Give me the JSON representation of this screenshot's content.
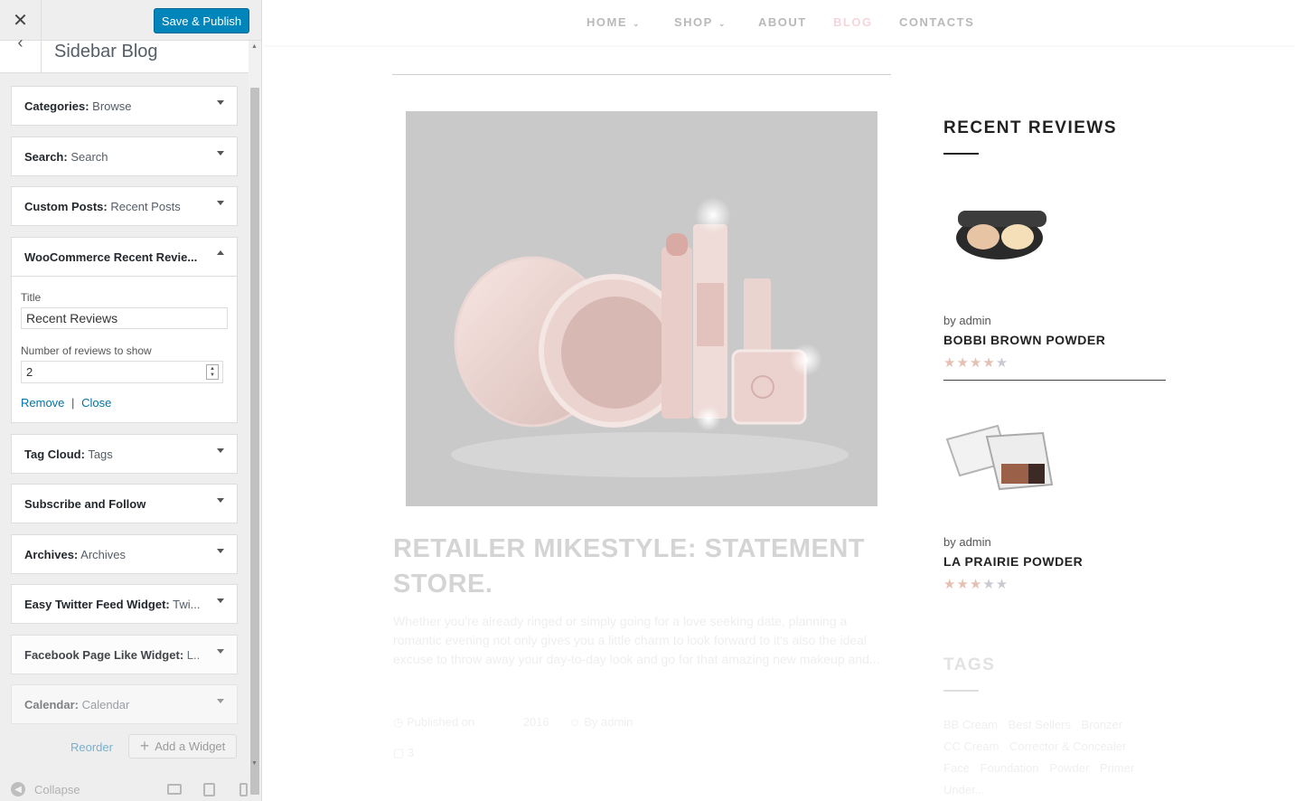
{
  "panel": {
    "close_glyph": "✕",
    "save_label": "Save & Publish",
    "back_glyph": "‹",
    "section_title": "Sidebar Blog",
    "widgets": [
      {
        "name": "Categories",
        "sub": "Browse"
      },
      {
        "name": "Search",
        "sub": "Search"
      },
      {
        "name": "Custom Posts",
        "sub": "Recent Posts"
      },
      {
        "name": "WooCommerce Recent Revie...",
        "sub": ""
      },
      {
        "name": "Tag Cloud",
        "sub": "Tags"
      },
      {
        "name": "Subscribe and Follow",
        "sub": ""
      },
      {
        "name": "Archives",
        "sub": "Archives"
      },
      {
        "name": "Easy Twitter Feed Widget",
        "sub": "Twi..."
      },
      {
        "name": "Facebook Page Like Widget",
        "sub": "L..."
      },
      {
        "name": "Calendar",
        "sub": "Calendar"
      }
    ],
    "open_widget": {
      "title_label": "Title",
      "title_value": "Recent Reviews",
      "count_label": "Number of reviews to show",
      "count_value": "2",
      "remove_label": "Remove",
      "separator": "|",
      "close_label": "Close"
    },
    "reorder_label": "Reorder",
    "add_widget_label": "Add a Widget",
    "add_widget_glyph": "+",
    "collapse_label": "Collapse"
  },
  "preview": {
    "nav": [
      {
        "label": "HOME",
        "caret": "⌄"
      },
      {
        "label": "SHOP",
        "caret": "⌄"
      },
      {
        "label": "ABOUT",
        "caret": ""
      },
      {
        "label": "BLOG",
        "caret": ""
      },
      {
        "label": "CONTACTS",
        "caret": ""
      }
    ],
    "post": {
      "title": "RETAILER MIKESTYLE: STATEMENT STORE.",
      "excerpt": "Whether you're already ringed or simply going for a love seeking date, planning a romantic evening not only gives you a little charm to look forward to it's also the ideal excuse to throw away your day-to-day look and go for that amazing new makeup and...",
      "meta_published": "Published on",
      "meta_date": "2016",
      "meta_author": "By admin",
      "comments": "3"
    },
    "recent_reviews": {
      "heading": "RECENT REVIEWS",
      "items": [
        {
          "by": "by admin",
          "name": "BOBBI BROWN POWDER",
          "rating": 4
        },
        {
          "by": "by admin",
          "name": "LA PRAIRIE POWDER",
          "rating": 3
        }
      ]
    },
    "tags": {
      "heading": "TAGS",
      "items": [
        "BB Cream",
        "Best Sellers",
        "Bronzer",
        "CC Cream",
        "Corrector & Concealer",
        "Face",
        "Foundation",
        "Powder",
        "Primer Under..."
      ]
    }
  }
}
